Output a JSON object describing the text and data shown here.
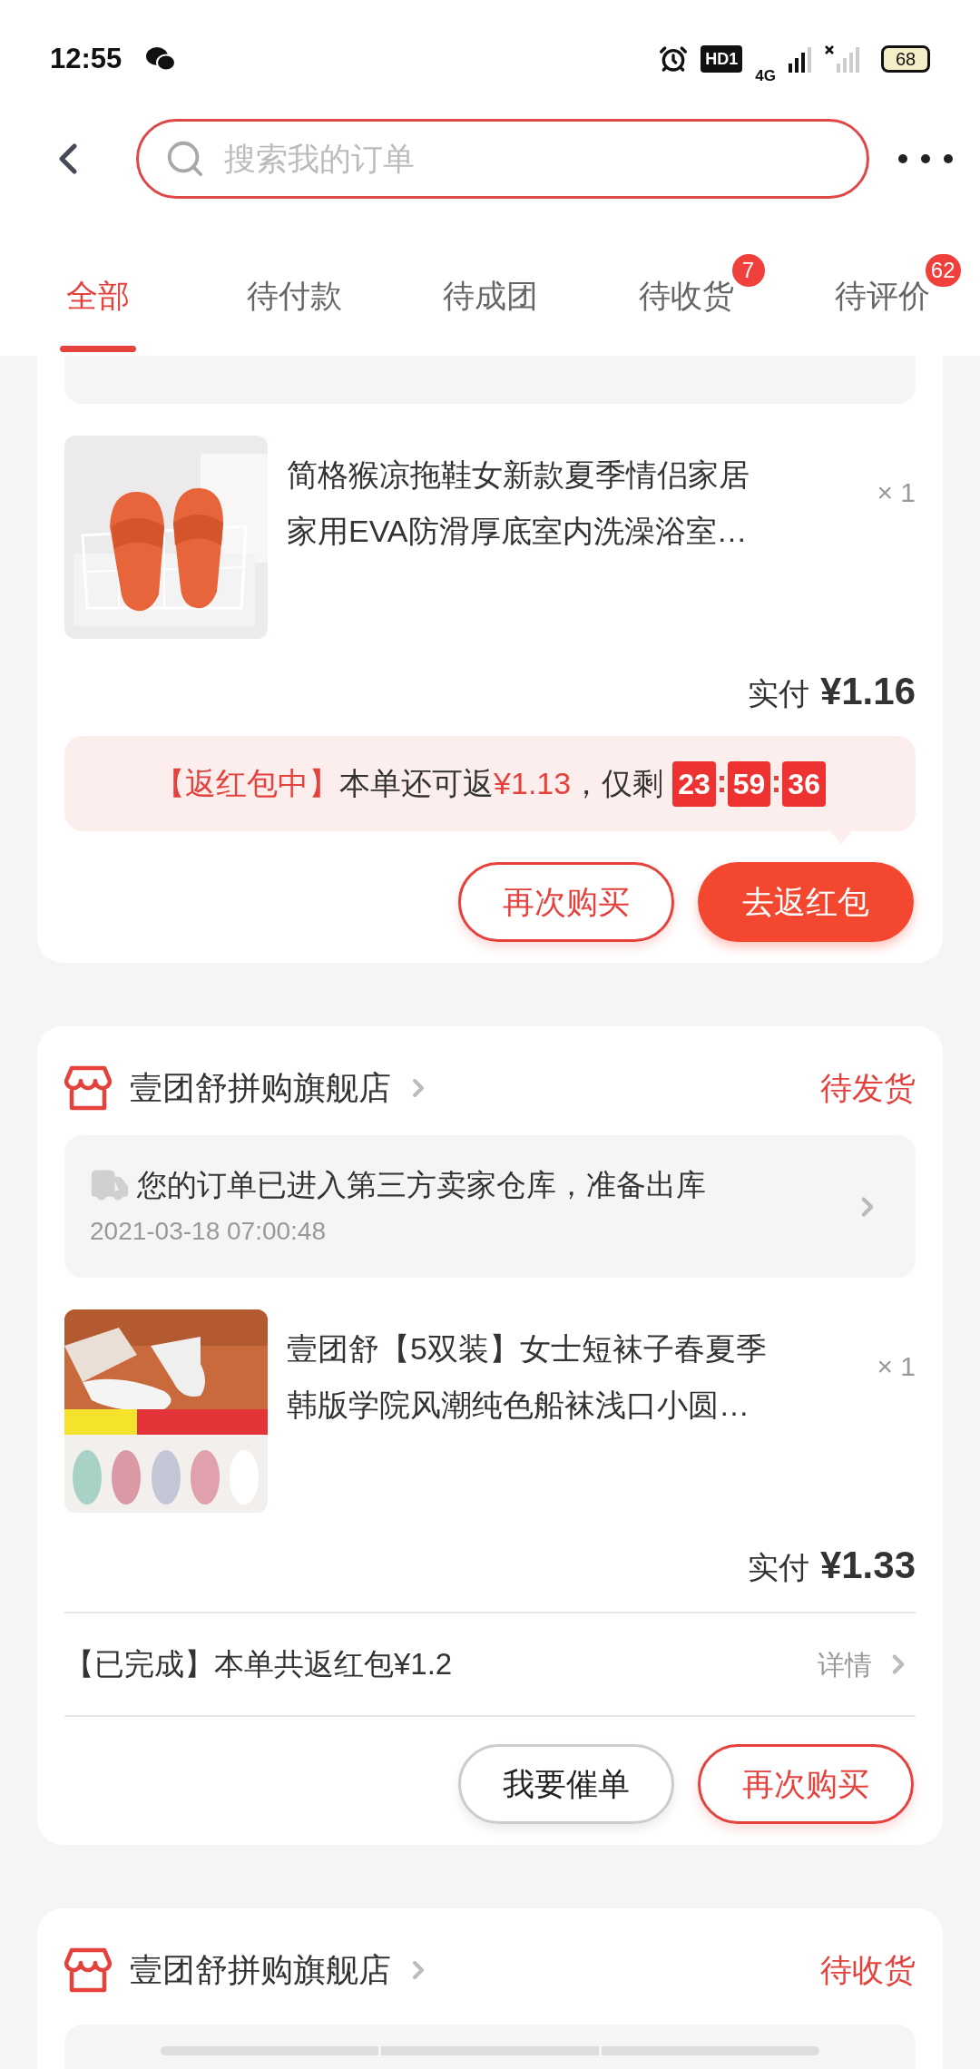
{
  "status_bar": {
    "time": "12:55",
    "hd_label": "HD1",
    "network_label": "4G",
    "battery": "68"
  },
  "search": {
    "placeholder": "搜索我的订单"
  },
  "tabs": [
    {
      "label": "全部",
      "selected": true
    },
    {
      "label": "待付款",
      "selected": false
    },
    {
      "label": "待成团",
      "selected": false
    },
    {
      "label": "待收货",
      "selected": false,
      "badge": "7"
    },
    {
      "label": "待评价",
      "selected": false,
      "badge": "62"
    }
  ],
  "orders": [
    {
      "kind": "partial",
      "items": [
        {
          "title_lines": [
            "简格猴凉拖鞋女新款夏季情侣家居",
            "家用EVA防滑厚底室内洗澡浴室…"
          ],
          "quantity": "× 1",
          "kind": "picture"
        }
      ],
      "paid_label": "实付",
      "paid": "¥1.16",
      "rebate": {
        "kind": "countdown",
        "label": "【返红包中】",
        "text": "本单还可返",
        "amount": "¥1.13",
        "tail": "，仅剩",
        "countdown": [
          "23",
          "59",
          "36"
        ]
      },
      "buttons": [
        {
          "label": "再次购买",
          "kind": "outline-red"
        },
        {
          "label": "去返红包",
          "kind": "filled"
        }
      ]
    },
    {
      "kind": "full",
      "shop": "壹团舒拼购旗舰店",
      "status": "待发货",
      "tracking": {
        "text": "您的订单已进入第三方卖家仓库，准备出库",
        "time": "2021-03-18 07:00:48"
      },
      "items": [
        {
          "title_lines": [
            "壹团舒【5双装】女士短袜子春夏季",
            "韩版学院风潮纯色船袜浅口小圆…"
          ],
          "quantity": "× 1",
          "kind": "picture"
        }
      ],
      "paid_label": "实付",
      "paid": "¥1.33",
      "rebate": {
        "kind": "done",
        "text": "【已完成】本单共返红包¥1.2",
        "link": "详情"
      },
      "buttons": [
        {
          "label": "我要催单",
          "kind": "outline-gray"
        },
        {
          "label": "再次购买",
          "kind": "outline-red"
        }
      ]
    },
    {
      "kind": "loading",
      "shop": "壹团舒拼购旗舰店",
      "status": "待收货"
    }
  ]
}
